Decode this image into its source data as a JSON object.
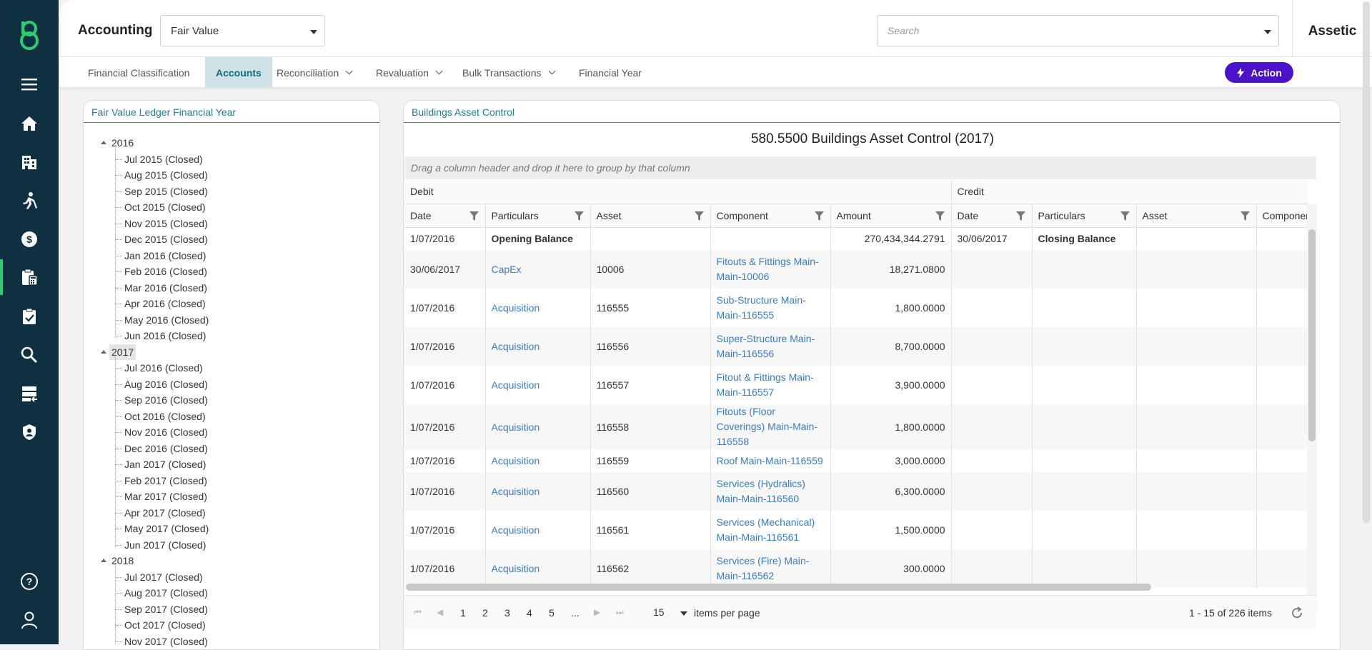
{
  "app": {
    "module_title": "Accounting",
    "ledger_value": "Fair Value",
    "search_placeholder": "Search",
    "brand": "Assetic"
  },
  "tabs": [
    {
      "label": "Financial Classification"
    },
    {
      "label": "Accounts"
    },
    {
      "label": "Reconciliation"
    },
    {
      "label": "Revaluation"
    },
    {
      "label": "Bulk Transactions"
    },
    {
      "label": "Financial Year"
    }
  ],
  "action_label": "Action",
  "sidebar_icons": [
    "menu-icon",
    "home-icon",
    "building-icon",
    "worker-icon",
    "finance-icon",
    "accounting-icon",
    "task-icon",
    "search-icon",
    "data-import-icon",
    "security-shield-icon",
    "help-icon",
    "user-icon"
  ],
  "tree": {
    "title": "Fair Value Ledger Financial Year",
    "years": [
      {
        "year": "2016",
        "months": [
          "Jul 2015 (Closed)",
          "Aug 2015 (Closed)",
          "Sep 2015 (Closed)",
          "Oct 2015 (Closed)",
          "Nov 2015 (Closed)",
          "Dec 2015 (Closed)",
          "Jan 2016 (Closed)",
          "Feb 2016 (Closed)",
          "Mar 2016 (Closed)",
          "Apr 2016 (Closed)",
          "May 2016 (Closed)",
          "Jun 2016 (Closed)"
        ]
      },
      {
        "year": "2017",
        "months": [
          "Jul 2016 (Closed)",
          "Aug 2016 (Closed)",
          "Sep 2016 (Closed)",
          "Oct 2016 (Closed)",
          "Nov 2016 (Closed)",
          "Dec 2016 (Closed)",
          "Jan 2017 (Closed)",
          "Feb 2017 (Closed)",
          "Mar 2017 (Closed)",
          "Apr 2017 (Closed)",
          "May 2017 (Closed)",
          "Jun 2017 (Closed)"
        ]
      },
      {
        "year": "2018",
        "months": [
          "Jul 2017 (Closed)",
          "Aug 2017 (Closed)",
          "Sep 2017 (Closed)",
          "Oct 2017 (Closed)",
          "Nov 2017 (Closed)"
        ]
      }
    ]
  },
  "grid": {
    "panel_title": "Buildings Asset Control",
    "title": "580.5500 Buildings Asset Control (2017)",
    "group_hint": "Drag a column header and drop it here to group by that column",
    "debit_label": "Debit",
    "credit_label": "Credit",
    "columns": [
      "Date",
      "Particulars",
      "Asset",
      "Component",
      "Amount",
      "Date",
      "Particulars",
      "Asset",
      "Componen"
    ],
    "rows": [
      {
        "date": "1/07/2016",
        "particulars": "Opening Balance",
        "asset": "",
        "component": "",
        "amount": "270,434,344.2791",
        "c_date": "30/06/2017",
        "c_particulars": "Closing Balance",
        "bold": true
      },
      {
        "date": "30/06/2017",
        "particulars": "CapEx",
        "asset": "10006",
        "component": "Fitouts & Fittings Main-Main-10006",
        "amount": "18,271.0800",
        "c_date": "",
        "c_particulars": ""
      },
      {
        "date": "1/07/2016",
        "particulars": "Acquisition",
        "asset": "116555",
        "component": "Sub-Structure Main-Main-116555",
        "amount": "1,800.0000",
        "c_date": "",
        "c_particulars": ""
      },
      {
        "date": "1/07/2016",
        "particulars": "Acquisition",
        "asset": "116556",
        "component": "Super-Structure Main-Main-116556",
        "amount": "8,700.0000",
        "c_date": "",
        "c_particulars": ""
      },
      {
        "date": "1/07/2016",
        "particulars": "Acquisition",
        "asset": "116557",
        "component": "Fitout & Fittings Main-Main-116557",
        "amount": "3,900.0000",
        "c_date": "",
        "c_particulars": ""
      },
      {
        "date": "1/07/2016",
        "particulars": "Acquisition",
        "asset": "116558",
        "component": "Fitouts (Floor Coverings) Main-Main-116558",
        "amount": "1,800.0000",
        "c_date": "",
        "c_particulars": ""
      },
      {
        "date": "1/07/2016",
        "particulars": "Acquisition",
        "asset": "116559",
        "component": "Roof Main-Main-116559",
        "amount": "3,000.0000",
        "c_date": "",
        "c_particulars": ""
      },
      {
        "date": "1/07/2016",
        "particulars": "Acquisition",
        "asset": "116560",
        "component": "Services (Hydralics) Main-Main-116560",
        "amount": "6,300.0000",
        "c_date": "",
        "c_particulars": ""
      },
      {
        "date": "1/07/2016",
        "particulars": "Acquisition",
        "asset": "116561",
        "component": "Services (Mechanical) Main-Main-116561",
        "amount": "1,500.0000",
        "c_date": "",
        "c_particulars": ""
      },
      {
        "date": "1/07/2016",
        "particulars": "Acquisition",
        "asset": "116562",
        "component": "Services (Fire) Main-Main-116562",
        "amount": "300.0000",
        "c_date": "",
        "c_particulars": ""
      }
    ],
    "pager": {
      "pages": [
        "1",
        "2",
        "3",
        "4",
        "5",
        "..."
      ],
      "page_size": "15",
      "items_per_page_label": "items per page",
      "summary": "1 - 15 of 226 items"
    }
  },
  "colors": {
    "sidebar": "#0f3040",
    "accent_green": "#2ecc71",
    "tab_active_bg": "#cfe3e6",
    "teal": "#1f7f92",
    "action_purple": "#4a12c9",
    "link_blue": "#3b7dbf"
  }
}
